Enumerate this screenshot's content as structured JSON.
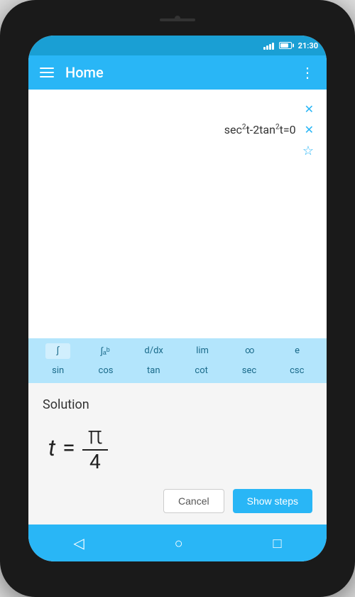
{
  "status_bar": {
    "time": "21:30"
  },
  "toolbar": {
    "title": "Home",
    "menu_icon": "≡",
    "more_icon": "⋮"
  },
  "equation": {
    "text": "sec²t-2tan²t=0",
    "display": "sec²t-2tan²t=0"
  },
  "keyboard": {
    "row1": [
      "∫",
      "∫ₐᵇ",
      "d/dx",
      "lim",
      "∞",
      "e"
    ],
    "row2": [
      "sin",
      "cos",
      "tan",
      "cot",
      "sec",
      "csc"
    ]
  },
  "solution": {
    "title": "Solution",
    "variable": "t",
    "equals": "=",
    "numerator": "π",
    "denominator": "4"
  },
  "buttons": {
    "cancel": "Cancel",
    "show_steps": "Show steps"
  },
  "nav": {
    "back_icon": "◁",
    "home_icon": "○",
    "square_icon": "□"
  },
  "colors": {
    "primary": "#29b6f6",
    "dark_primary": "#1a9fd4",
    "keyboard_bg": "#b3e5fc"
  }
}
